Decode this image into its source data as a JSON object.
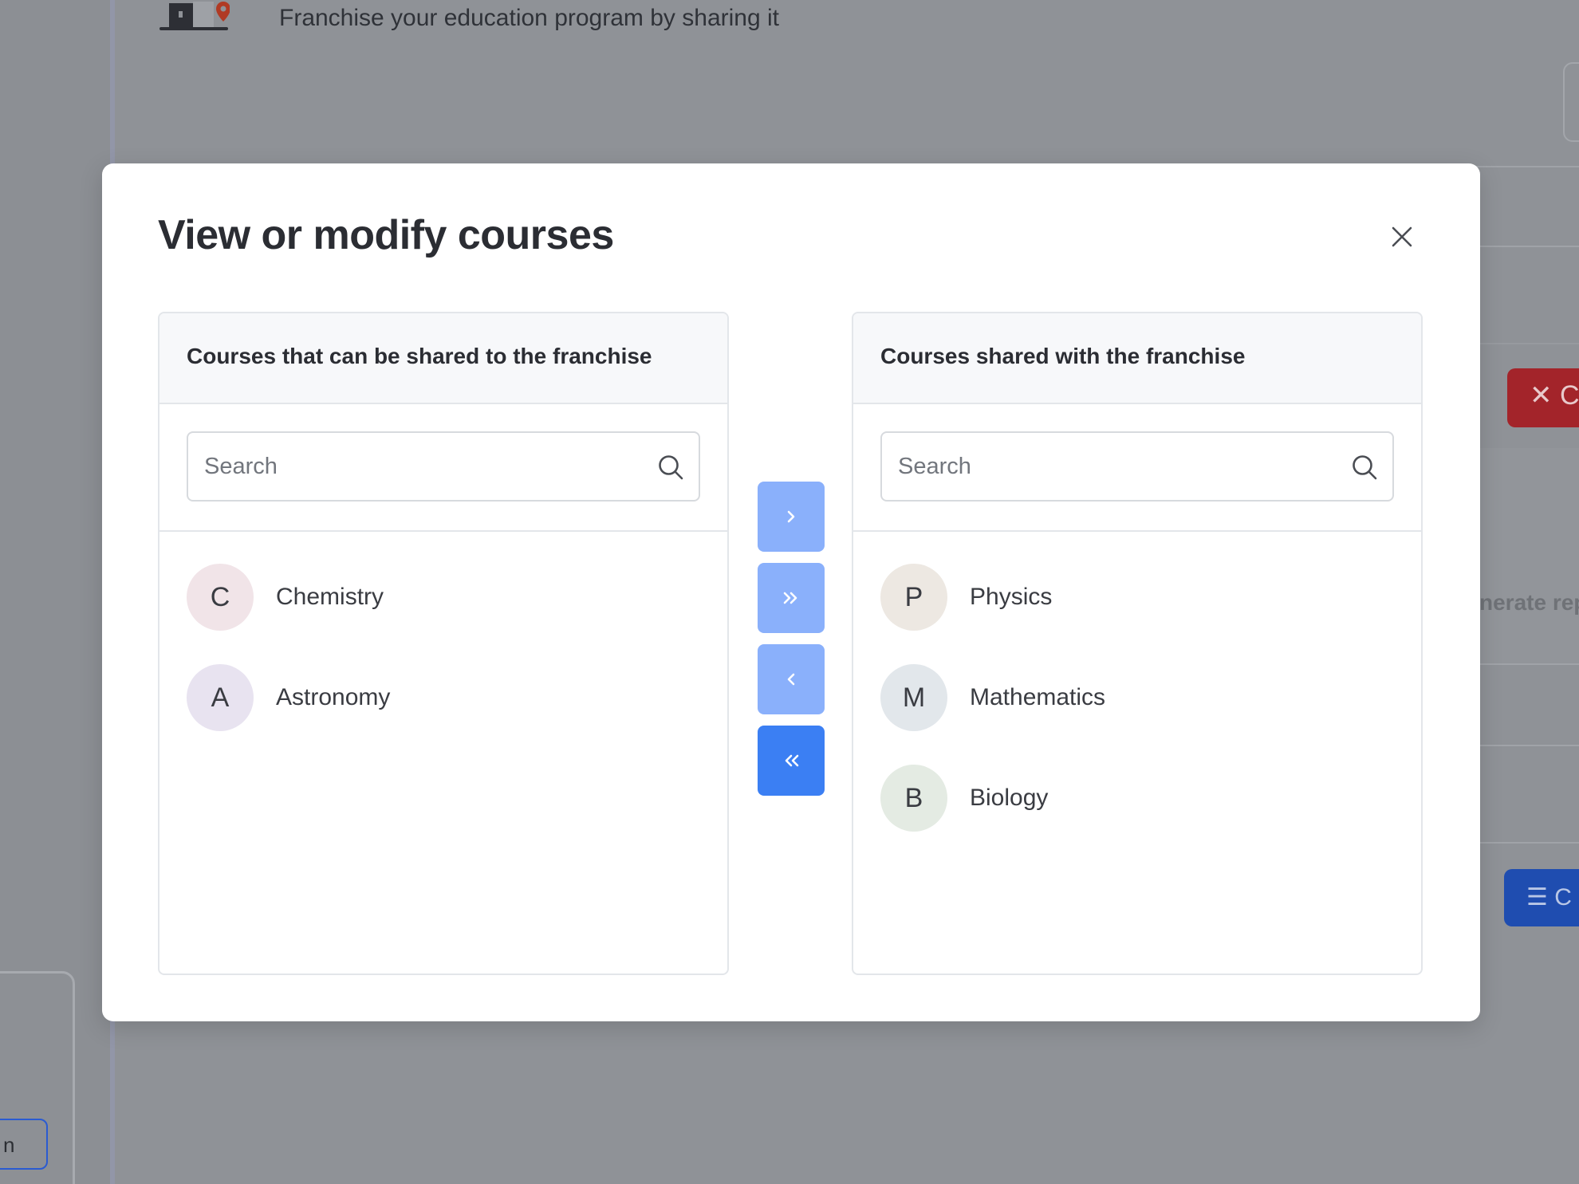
{
  "background": {
    "subtitle": "Franchise your education program by sharing it",
    "red_button_label": "C",
    "blue_button_label": "C",
    "generate_text": "nerate rep",
    "bottom_button_label": "n"
  },
  "modal": {
    "title": "View or modify courses",
    "close_icon": "close-icon",
    "left_panel": {
      "header": "Courses that can be shared to the franchise",
      "search_placeholder": "Search",
      "items": [
        {
          "initial": "C",
          "label": "Chemistry",
          "avatar_color": "#f1e4e8"
        },
        {
          "initial": "A",
          "label": "Astronomy",
          "avatar_color": "#e8e3f0"
        }
      ]
    },
    "right_panel": {
      "header": "Courses shared with the franchise",
      "search_placeholder": "Search",
      "items": [
        {
          "initial": "P",
          "label": "Physics",
          "avatar_color": "#ede8e2"
        },
        {
          "initial": "M",
          "label": "Mathematics",
          "avatar_color": "#e2e7eb"
        },
        {
          "initial": "B",
          "label": "Biology",
          "avatar_color": "#e4ebe3"
        }
      ]
    },
    "transfer_buttons": [
      {
        "icon": "chevron-right-icon",
        "state": "disabled"
      },
      {
        "icon": "double-chevron-right-icon",
        "state": "disabled"
      },
      {
        "icon": "chevron-left-icon",
        "state": "disabled"
      },
      {
        "icon": "double-chevron-left-icon",
        "state": "enabled"
      }
    ]
  },
  "colors": {
    "accent": "#3b7ff3",
    "accent_disabled": "#8ab0fb",
    "danger": "#a3242a"
  }
}
